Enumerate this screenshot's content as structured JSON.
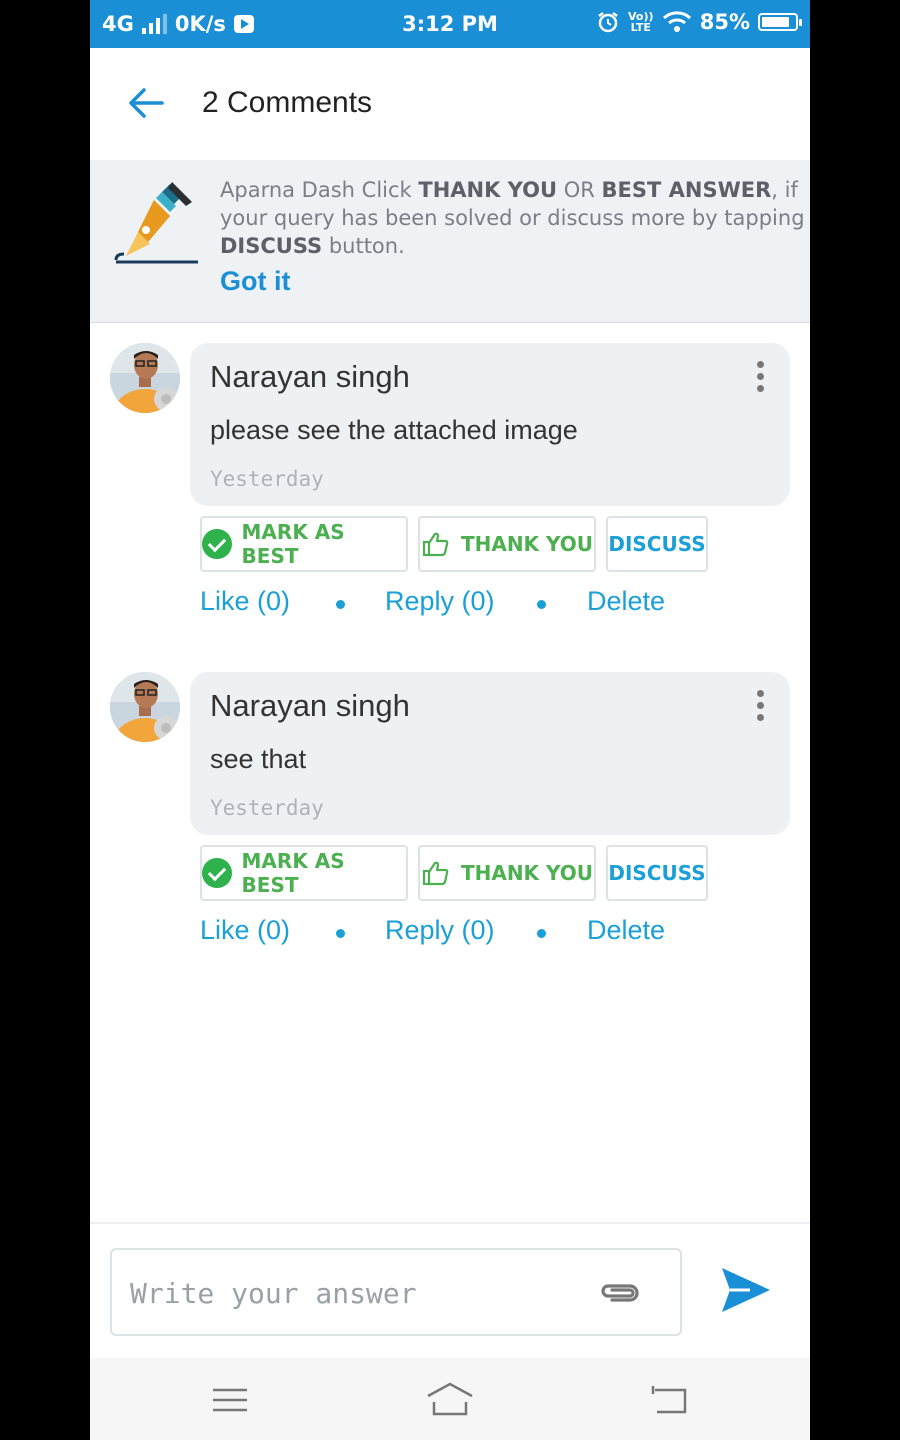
{
  "status_bar": {
    "network": "4G",
    "speed": "0K/s",
    "time": "3:12 PM",
    "volte": "Vo)) LTE",
    "battery": "85%",
    "battery_level": 0.85
  },
  "header": {
    "title": "2 Comments"
  },
  "tip": {
    "name": "Aparna Dash",
    "p1": " Click ",
    "thank": "THANK YOU",
    "or": " OR ",
    "best": "BEST ANSWER",
    "p2": ", if your query has been solved or discuss more by tapping ",
    "discuss": "DISCUSS",
    "p3": " button.",
    "got_it": "Got it"
  },
  "comments": [
    {
      "author": "Narayan singh",
      "text": "please see the attached image",
      "time": "Yesterday",
      "mark_best": "MARK AS BEST",
      "thank_you": "THANK YOU",
      "discuss": "DISCUSS",
      "like": "Like (0)",
      "reply": "Reply (0)",
      "delete": "Delete"
    },
    {
      "author": "Narayan singh",
      "text": "see that",
      "time": "Yesterday",
      "mark_best": "MARK AS BEST",
      "thank_you": "THANK YOU",
      "discuss": "DISCUSS",
      "like": "Like (0)",
      "reply": "Reply (0)",
      "delete": "Delete"
    }
  ],
  "composer": {
    "placeholder": "Write your answer"
  },
  "colors": {
    "accent": "#1a8fd6",
    "green": "#4caf50",
    "bubble": "#edf1f4"
  }
}
